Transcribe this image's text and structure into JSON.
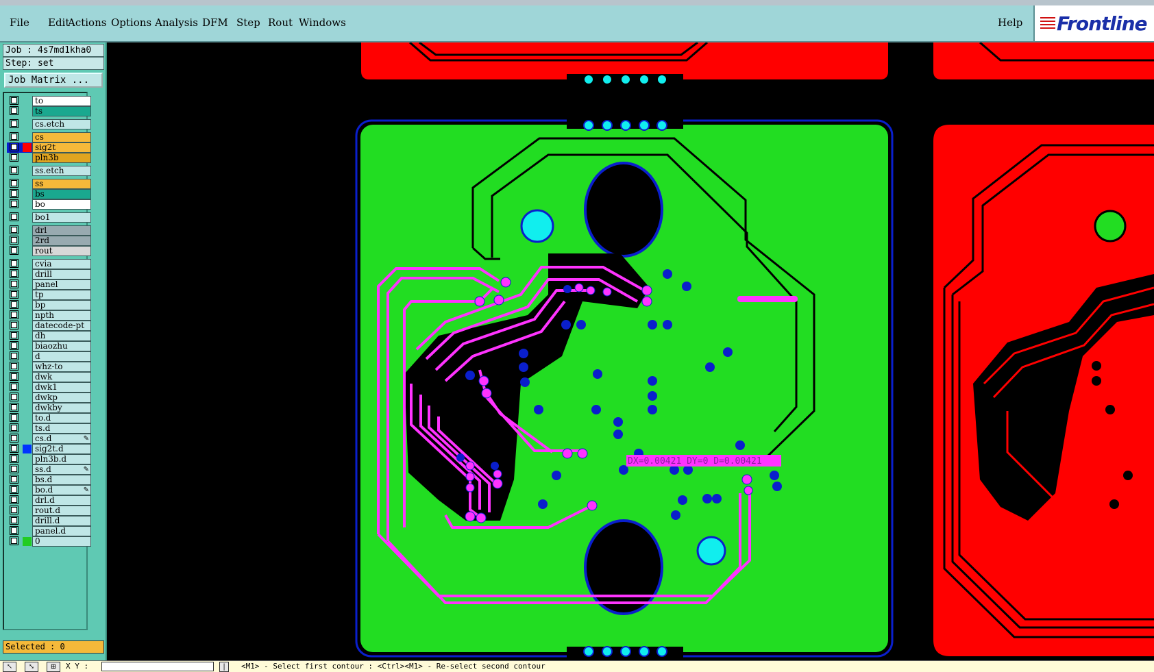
{
  "menu": {
    "items": [
      "File",
      "Edit",
      "Actions",
      "Options",
      "Analysis",
      "DFM",
      "Step",
      "Rout",
      "Windows"
    ],
    "help": "Help",
    "logo_text": "Frontline"
  },
  "job": {
    "job_label": "Job : 4s7md1kha0",
    "step_label": "Step: set",
    "matrix_button": "Job Matrix ..."
  },
  "layers": [
    {
      "name": "to",
      "color": "#ffffff"
    },
    {
      "name": "ts",
      "color": "#1aa88f"
    },
    {
      "name": "cs.etch",
      "color": "#bfe6e6"
    },
    {
      "name": "cs",
      "color": "#f5b93a"
    },
    {
      "name": "sig2t",
      "color": "#f5b93a",
      "swatch": "#ff0000",
      "active": true
    },
    {
      "name": "pln3b",
      "color": "#e0a520"
    },
    {
      "name": "ss.etch",
      "color": "#bfe6e6"
    },
    {
      "name": "ss",
      "color": "#f5b93a"
    },
    {
      "name": "bs",
      "color": "#1aa88f"
    },
    {
      "name": "bo",
      "color": "#ffffff"
    },
    {
      "name": "bo1",
      "color": "#bfe6e6"
    },
    {
      "name": "drl",
      "color": "#98aab0"
    },
    {
      "name": "2rd",
      "color": "#98aab0"
    },
    {
      "name": "rout",
      "color": "#d8d8d8"
    },
    {
      "name": "cvia",
      "color": "#bfe6e6"
    },
    {
      "name": "drill",
      "color": "#bfe6e6"
    },
    {
      "name": "panel",
      "color": "#bfe6e6"
    },
    {
      "name": "tp",
      "color": "#bfe6e6"
    },
    {
      "name": "bp",
      "color": "#bfe6e6"
    },
    {
      "name": "npth",
      "color": "#bfe6e6"
    },
    {
      "name": "datecode-pt",
      "color": "#bfe6e6"
    },
    {
      "name": "dh",
      "color": "#bfe6e6"
    },
    {
      "name": "biaozhu",
      "color": "#bfe6e6"
    },
    {
      "name": "d",
      "color": "#bfe6e6"
    },
    {
      "name": "whz-to",
      "color": "#bfe6e6"
    },
    {
      "name": "dwk",
      "color": "#bfe6e6"
    },
    {
      "name": "dwk1",
      "color": "#bfe6e6"
    },
    {
      "name": "dwkp",
      "color": "#bfe6e6"
    },
    {
      "name": "dwkby",
      "color": "#bfe6e6"
    },
    {
      "name": "to.d",
      "color": "#bfe6e6"
    },
    {
      "name": "ts.d",
      "color": "#bfe6e6"
    },
    {
      "name": "cs.d",
      "color": "#bfe6e6",
      "mark": "✎"
    },
    {
      "name": "sig2t.d",
      "color": "#bfe6e6",
      "swatch": "#0033ff"
    },
    {
      "name": "pln3b.d",
      "color": "#bfe6e6"
    },
    {
      "name": "ss.d",
      "color": "#bfe6e6",
      "mark": "✎"
    },
    {
      "name": "bs.d",
      "color": "#bfe6e6"
    },
    {
      "name": "bo.d",
      "color": "#bfe6e6",
      "mark": "✎"
    },
    {
      "name": "drl.d",
      "color": "#bfe6e6"
    },
    {
      "name": "rout.d",
      "color": "#bfe6e6"
    },
    {
      "name": "drill.d",
      "color": "#bfe6e6"
    },
    {
      "name": "panel.d",
      "color": "#bfe6e6"
    },
    {
      "name": "0",
      "color": "#bfe6e6",
      "swatch": "#22cc22"
    }
  ],
  "selected_label": "Selected : 0",
  "status": {
    "xy_label": "X Y :",
    "message": "<M1> - Select first contour : <Ctrl><M1> - Re-select second contour"
  },
  "measurement": "DX=0.00421 DY=0 D=0.00421",
  "colors": {
    "board_green": "#22dd22",
    "board_red": "#ff0000",
    "trace_magenta": "#ff33ff",
    "via_blue": "#0a1fcc",
    "fiducial_cyan": "#11eeee"
  }
}
